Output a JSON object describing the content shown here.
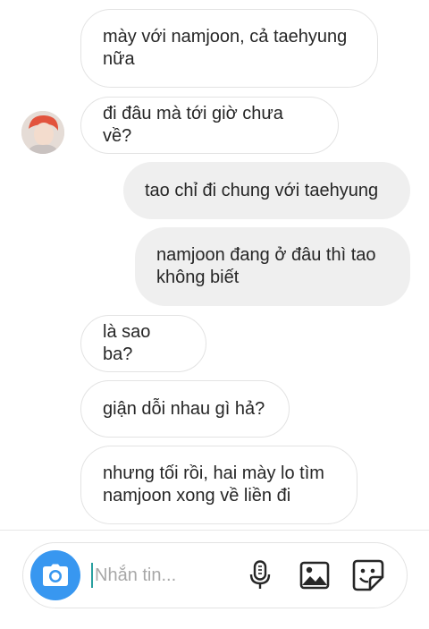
{
  "messages": [
    {
      "side": "in",
      "text": "mày với namjoon, cả taehyung\nnữa"
    },
    {
      "side": "in",
      "text": "đi đâu mà tới giờ chưa về?"
    },
    {
      "side": "out",
      "text": "tao chỉ đi chung với taehyung"
    },
    {
      "side": "out",
      "text": "namjoon đang ở đâu thì tao\nkhông biết"
    },
    {
      "side": "in",
      "text": "là sao ba?"
    },
    {
      "side": "in",
      "text": "giận dỗi nhau gì hả?"
    },
    {
      "side": "in",
      "text": "nhưng tối rồi, hai mày lo tìm\nnamjoon xong về liền đi"
    }
  ],
  "composer": {
    "placeholder": "Nhắn tin...",
    "icons": [
      "camera-icon",
      "microphone-icon",
      "gallery-icon",
      "sticker-icon"
    ]
  },
  "colors": {
    "accent": "#3897f0",
    "incoming_border": "#e3e3e3",
    "outgoing_bg": "#efefef",
    "text": "#262626"
  }
}
